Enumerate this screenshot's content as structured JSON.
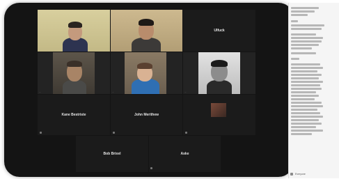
{
  "tiles": {
    "t0": {
      "caption": "..."
    },
    "t1": {
      "caption": "..."
    },
    "t2": {
      "name": "Ulfuck"
    },
    "t3": {
      "caption": "..."
    },
    "t4": {
      "caption": "..."
    },
    "t5": {
      "caption": "..."
    },
    "t6": {
      "name": "Kane Bestriste"
    },
    "t7": {
      "name": "John Merithew"
    },
    "t9": {
      "name": "Bob Brixel"
    },
    "t10": {
      "name": "Aske"
    }
  },
  "chat": {
    "footer_label": "Everyone"
  },
  "colors": {
    "call_background": "#141414",
    "tile_background": "#232323",
    "chat_background": "#f5f5f5"
  }
}
